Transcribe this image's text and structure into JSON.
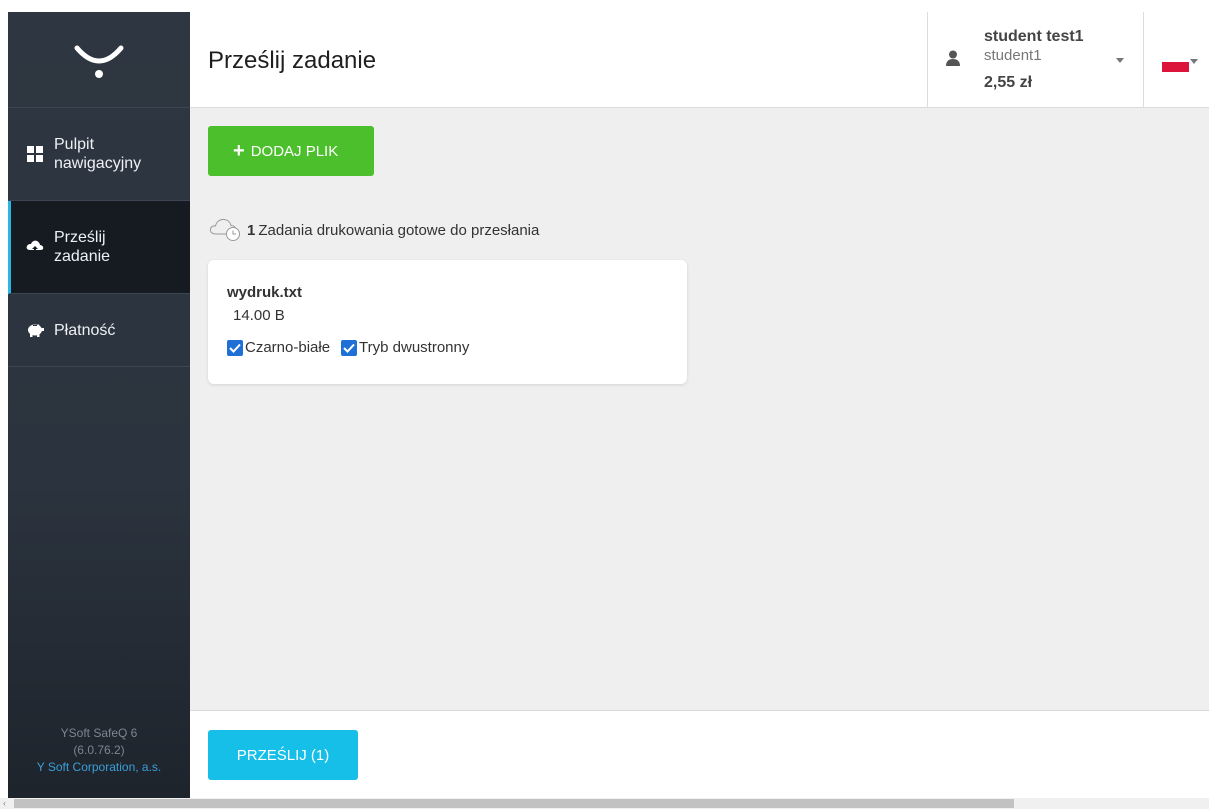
{
  "sidebar": {
    "items": [
      {
        "label_line1": "Pulpit",
        "label_line2": "nawigacyjny",
        "icon": "grid-icon"
      },
      {
        "label_line1": "Prześlij",
        "label_line2": "zadanie",
        "icon": "cloud-upload-icon",
        "active": true
      },
      {
        "label_line1": "Płatność",
        "icon": "piggy-bank-icon"
      }
    ],
    "footer": {
      "product": "YSoft SafeQ 6",
      "version": "(6.0.76.2)",
      "company": "Y Soft Corporation, a.s."
    }
  },
  "header": {
    "title": "Prześlij zadanie",
    "user": {
      "full_name": "student test1",
      "login": "student1",
      "balance": "2,55 zł"
    },
    "language_flag_color": "#dc143c"
  },
  "main": {
    "add_button_label": "DODAJ PLIK",
    "queue": {
      "count": "1",
      "text": "Zadania drukowania gotowe do przesłania"
    },
    "jobs": [
      {
        "file_name": "wydruk.txt",
        "size": "14.00 B",
        "options": [
          {
            "label": "Czarno-białe",
            "checked": true
          },
          {
            "label": "Tryb dwustronny",
            "checked": true
          }
        ]
      }
    ]
  },
  "footer": {
    "submit_label": "PRZEŚLIJ (1)"
  },
  "colors": {
    "sidebar_bg": "#2e3641",
    "accent_green": "#4cc02c",
    "accent_blue": "#15bfe8",
    "active_indicator": "#2bb7e5",
    "checkbox": "#1e6fd6"
  }
}
